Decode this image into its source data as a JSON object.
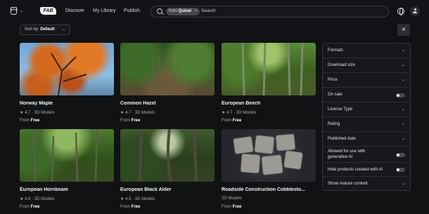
{
  "header": {
    "logo_text": "FAB",
    "epic_logo_text": "EPIC",
    "nav": [
      "Discover",
      "My Library",
      "Publish"
    ],
    "search_chip_prefix": "from",
    "search_chip_value": "Quixel",
    "search_placeholder": "Search"
  },
  "toolbar": {
    "sort_label": "Sort by:",
    "sort_value": "Default",
    "close_label": "×"
  },
  "cards": [
    {
      "title": "Norway Maple",
      "rating": "4.7",
      "category": "3D Models",
      "price_prefix": "From",
      "price": "Free"
    },
    {
      "title": "Common Hazel",
      "rating": "4.7",
      "category": "3D Models",
      "price_prefix": "From",
      "price": "Free"
    },
    {
      "title": "European Beech",
      "rating": "4.7",
      "category": "3D Models",
      "price_prefix": "From",
      "price": "Free"
    },
    {
      "title": "European Hornbeam",
      "rating": "4.6",
      "category": "3D Models",
      "price_prefix": "From",
      "price": "Free"
    },
    {
      "title": "European Black Alder",
      "rating": "4.5",
      "category": "3D Models",
      "price_prefix": "From",
      "price": "Free"
    },
    {
      "title": "Roadside Construction Cobblesto...",
      "rating": "",
      "category": "3D Models",
      "price_prefix": "From",
      "price": "Free"
    }
  ],
  "filters": [
    {
      "label": "Formats",
      "control": "chevron"
    },
    {
      "label": "Download size",
      "control": "chevron"
    },
    {
      "label": "Price",
      "control": "chevron"
    },
    {
      "label": "On sale",
      "control": "toggle",
      "on": false
    },
    {
      "label": "License Type",
      "control": "chevron"
    },
    {
      "label": "Rating",
      "control": "chevron"
    },
    {
      "label": "Published date",
      "control": "chevron"
    },
    {
      "label": "Allowed for use with generative AI",
      "control": "toggle",
      "on": false
    },
    {
      "label": "Hide products created with AI",
      "control": "toggle",
      "on": false
    },
    {
      "label": "Show mature content",
      "control": "chevron"
    }
  ],
  "icons": {
    "globe": "globe-icon",
    "user": "user-icon",
    "search": "search-icon",
    "star": "★"
  }
}
